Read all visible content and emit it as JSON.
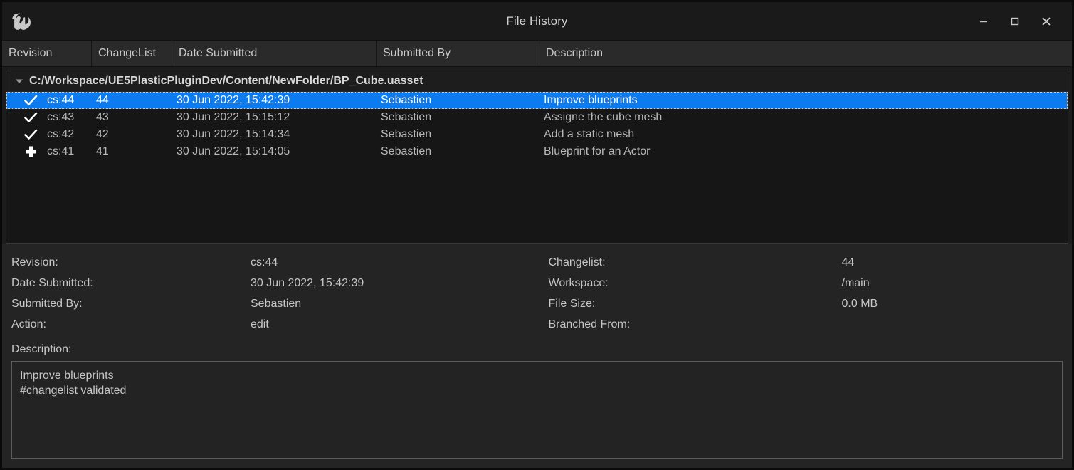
{
  "window": {
    "title": "File History",
    "logo_icon": "unreal-engine-logo",
    "controls": {
      "minimize": "minimize-icon",
      "maximize": "maximize-icon",
      "close": "close-icon"
    }
  },
  "columns": [
    {
      "key": "revision",
      "label": "Revision"
    },
    {
      "key": "changelist",
      "label": "ChangeList"
    },
    {
      "key": "date",
      "label": "Date Submitted"
    },
    {
      "key": "by",
      "label": "Submitted By"
    },
    {
      "key": "desc",
      "label": "Description"
    }
  ],
  "file": {
    "path": "C:/Workspace/UE5PlasticPluginDev/Content/NewFolder/BP_Cube.uasset",
    "expanded": true,
    "expander_icon": "chevron-down-icon"
  },
  "rows": [
    {
      "action_icon": "check-icon",
      "revision": "cs:44",
      "changelist": "44",
      "date": "30 Jun 2022, 15:42:39",
      "submitted_by": "Sebastien",
      "description": "Improve blueprints",
      "selected": true
    },
    {
      "action_icon": "check-icon",
      "revision": "cs:43",
      "changelist": "43",
      "date": "30 Jun 2022, 15:15:12",
      "submitted_by": "Sebastien",
      "description": "Assigne the cube mesh",
      "selected": false
    },
    {
      "action_icon": "check-icon",
      "revision": "cs:42",
      "changelist": "42",
      "date": "30 Jun 2022, 15:14:34",
      "submitted_by": "Sebastien",
      "description": "Add a static mesh",
      "selected": false
    },
    {
      "action_icon": "plus-icon",
      "revision": "cs:41",
      "changelist": "41",
      "date": "30 Jun 2022, 15:14:05",
      "submitted_by": "Sebastien",
      "description": "Blueprint for an Actor",
      "selected": false
    }
  ],
  "details": {
    "left": [
      {
        "label": "Revision:",
        "value": "cs:44"
      },
      {
        "label": "Date Submitted:",
        "value": "30 Jun 2022, 15:42:39"
      },
      {
        "label": "Submitted By:",
        "value": "Sebastien"
      },
      {
        "label": "Action:",
        "value": "edit"
      }
    ],
    "right": [
      {
        "label": "Changelist:",
        "value": "44"
      },
      {
        "label": "Workspace:",
        "value": "/main"
      },
      {
        "label": "File Size:",
        "value": "0.0 MB"
      },
      {
        "label": "Branched From:",
        "value": ""
      }
    ],
    "description_label": "Description:",
    "description_text": "Improve blueprints\n#changelist validated"
  },
  "colors": {
    "selection": "#0d7bf0",
    "window_bg": "#1d1d1d",
    "list_bg": "#161616",
    "details_bg": "#242424",
    "text": "#c6c6c6"
  }
}
